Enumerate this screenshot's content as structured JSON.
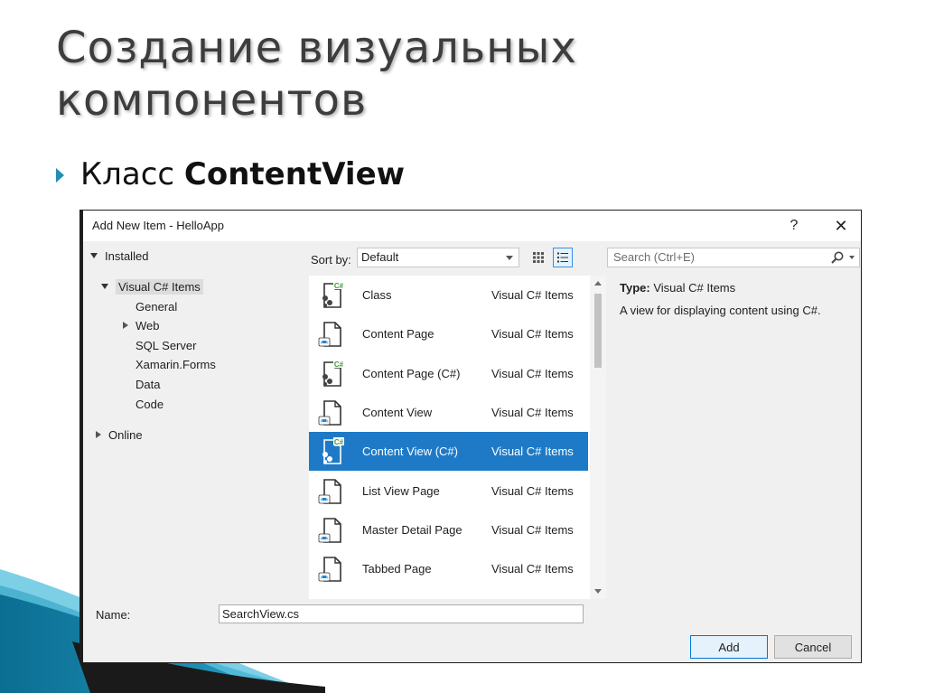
{
  "slide": {
    "title": "Создание визуальных компонентов",
    "bullet_prefix": "Класс ",
    "bullet_bold": "ContentView"
  },
  "dialog": {
    "title": "Add New Item - HelloApp",
    "help_label": "?",
    "close_label": "✕",
    "tree": {
      "installed": "Installed",
      "visual_csharp": "Visual C# Items",
      "general": "General",
      "web": "Web",
      "sql_server": "SQL Server",
      "xamarin_forms": "Xamarin.Forms",
      "data": "Data",
      "code": "Code",
      "online": "Online"
    },
    "toolbar": {
      "sort_label": "Sort by:",
      "sort_value": "Default",
      "search_placeholder": "Search (Ctrl+E)"
    },
    "items": [
      {
        "name": "Class",
        "category": "Visual C# Items",
        "icon": "csharp-class-icon"
      },
      {
        "name": "Content Page",
        "category": "Visual C# Items",
        "icon": "xaml-page-icon"
      },
      {
        "name": "Content Page (C#)",
        "category": "Visual C# Items",
        "icon": "csharp-class-icon"
      },
      {
        "name": "Content View",
        "category": "Visual C# Items",
        "icon": "xaml-page-icon"
      },
      {
        "name": "Content View (C#)",
        "category": "Visual C# Items",
        "icon": "csharp-class-icon"
      },
      {
        "name": "List View Page",
        "category": "Visual C# Items",
        "icon": "xaml-page-icon"
      },
      {
        "name": "Master Detail Page",
        "category": "Visual C# Items",
        "icon": "xaml-page-icon"
      },
      {
        "name": "Tabbed Page",
        "category": "Visual C# Items",
        "icon": "xaml-page-icon"
      }
    ],
    "selected_index": 4,
    "details": {
      "type_label": "Type:",
      "type_value": " Visual C# Items",
      "description": "A view for displaying content using C#."
    },
    "name_label": "Name:",
    "name_value": "SearchView.cs",
    "add_label": "Add",
    "cancel_label": "Cancel"
  },
  "colors": {
    "selection": "#1e7ac7",
    "accent_bullet": "#1f8fb3",
    "csharp_badge": "#3f9b35",
    "xaml_badge": "#1e88d6"
  }
}
